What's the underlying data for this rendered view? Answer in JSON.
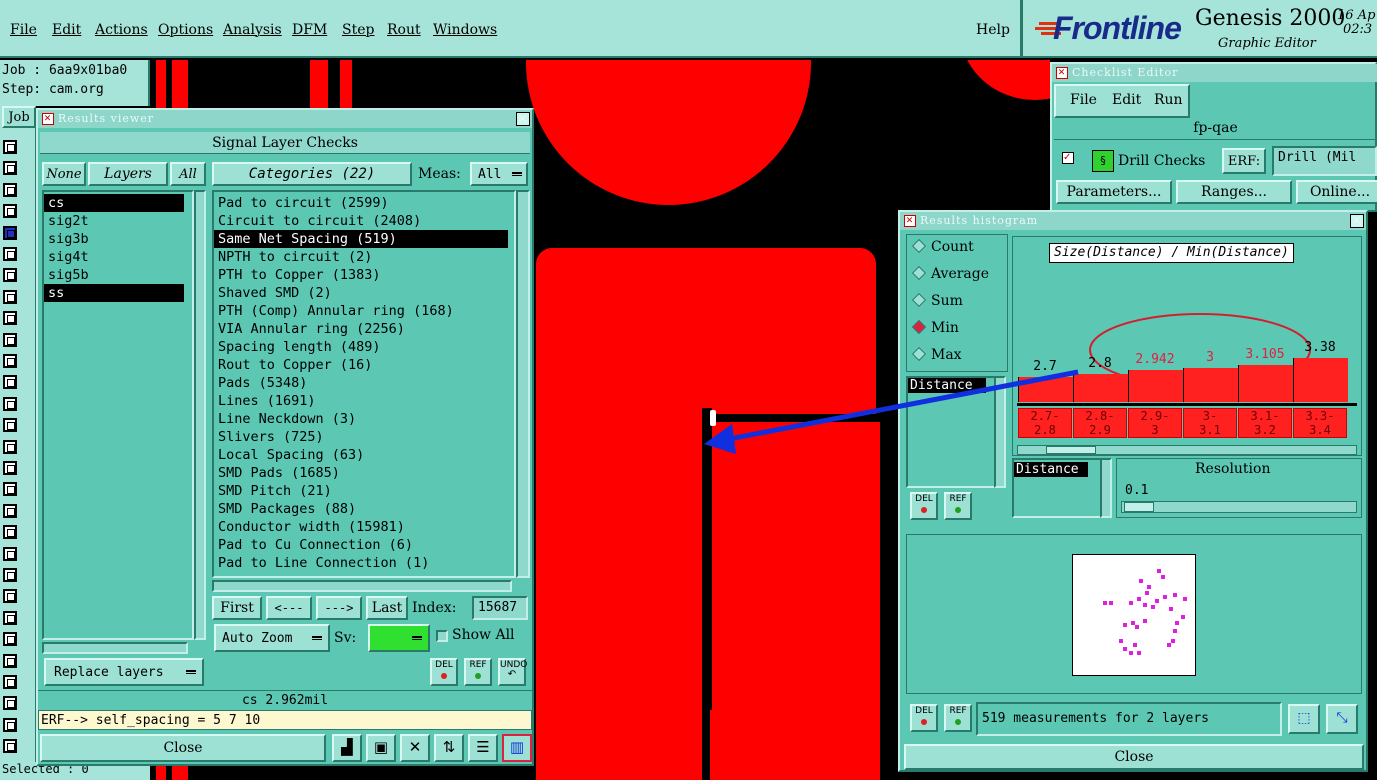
{
  "menubar": {
    "items": [
      "File",
      "Edit",
      "Actions",
      "Options",
      "Analysis",
      "DFM",
      "Step",
      "Rout",
      "Windows"
    ],
    "help": "Help"
  },
  "brand": {
    "logo": "Frontline",
    "product": "Genesis 2000",
    "subtitle": "Graphic Editor",
    "date": "16 Ap",
    "time": "02:3"
  },
  "job_info": {
    "job": "Job : 6aa9x01ba0",
    "step": "Step: cam.org",
    "job_btn": "Job",
    "selected": "Selected : 0"
  },
  "results_viewer": {
    "window_title": "Results viewer",
    "header": "Signal Layer Checks",
    "none_btn": "None",
    "layers_btn": "Layers",
    "all_btn": "All",
    "categories_btn": "Categories (22)",
    "meas_label": "Meas:",
    "meas_value": "All",
    "layers": [
      "cs",
      "sig2t",
      "sig3b",
      "sig4t",
      "sig5b",
      "ss"
    ],
    "categories": [
      "Pad to circuit (2599)",
      "Circuit to circuit (2408)",
      "Same Net Spacing (519)",
      "NPTH to circuit (2)",
      "PTH to Copper (1383)",
      "Shaved SMD (2)",
      "PTH (Comp) Annular ring (168)",
      "VIA Annular ring (2256)",
      "Spacing length (489)",
      "Rout to Copper (16)",
      "Pads (5348)",
      "Lines (1691)",
      "Line Neckdown (3)",
      "Slivers (725)",
      "Local Spacing (63)",
      "SMD Pads (1685)",
      "SMD Pitch (21)",
      "SMD Packages (88)",
      "Conductor width (15981)",
      "Pad to Cu Connection (6)",
      "Pad to Line Connection (1)"
    ],
    "first_btn": "First",
    "prev_btn": "<---",
    "next_btn": "--->",
    "last_btn": "Last",
    "index_label": "Index:",
    "index_value": "15687",
    "auto_zoom": "Auto Zoom",
    "sv_label": "Sv:",
    "show_all": "Show All",
    "replace_layers": "Replace layers",
    "del_label": "DEL",
    "ref_label": "REF",
    "undo_label": "UNDO",
    "status": "cs 2.962mil",
    "erf_line": "ERF--> self_spacing = 5 7 10",
    "close_btn": "Close"
  },
  "checklist_editor": {
    "window_title": "Checklist Editor",
    "menu": [
      "File",
      "Edit",
      "Run"
    ],
    "name": "fp-qae",
    "drill_checks": "Drill Checks",
    "erf_label": "ERF:",
    "erf_value": "Drill (Mil",
    "parameters_btn": "Parameters...",
    "ranges_btn": "Ranges...",
    "online_btn": "Online..."
  },
  "results_histogram": {
    "window_title": "Results histogram",
    "modes": [
      "Count",
      "Average",
      "Sum",
      "Min",
      "Max"
    ],
    "selected_mode": "Min",
    "title": "Size(Distance) / Min(Distance)",
    "distance_label": "Distance",
    "distance_label2": "Distance",
    "resolution_label": "Resolution",
    "resolution_value": "0.1",
    "del_label": "DEL",
    "ref_label": "REF",
    "measurements": "519 measurements for 2 layers",
    "close_btn": "Close"
  },
  "chart_data": {
    "type": "bar",
    "title": "Size(Distance) / Min(Distance)",
    "categories": [
      "2.7-2.8",
      "2.8-2.9",
      "2.9-3",
      "3-3.1",
      "3.1-3.2",
      "3.3-3.4"
    ],
    "values": [
      2.7,
      2.8,
      2.942,
      3,
      3.105,
      3.38
    ],
    "value_labels": [
      "2.7",
      "2.8",
      "2.942",
      "3",
      "3.105",
      "3.38"
    ],
    "bin_labels": [
      [
        "2.7-",
        "2.8"
      ],
      [
        "2.8-",
        "2.9"
      ],
      [
        "2.9-",
        "3"
      ],
      [
        "3-",
        "3.1"
      ],
      [
        "3.1-",
        "3.2"
      ],
      [
        "3.3-",
        "3.4"
      ]
    ],
    "highlighted": [
      false,
      false,
      true,
      true,
      true,
      false
    ]
  },
  "colors": {
    "panel": "#5cc8b4",
    "copper": "#ff0000",
    "arrow": "#1030e0",
    "highlight": "#e02040"
  }
}
